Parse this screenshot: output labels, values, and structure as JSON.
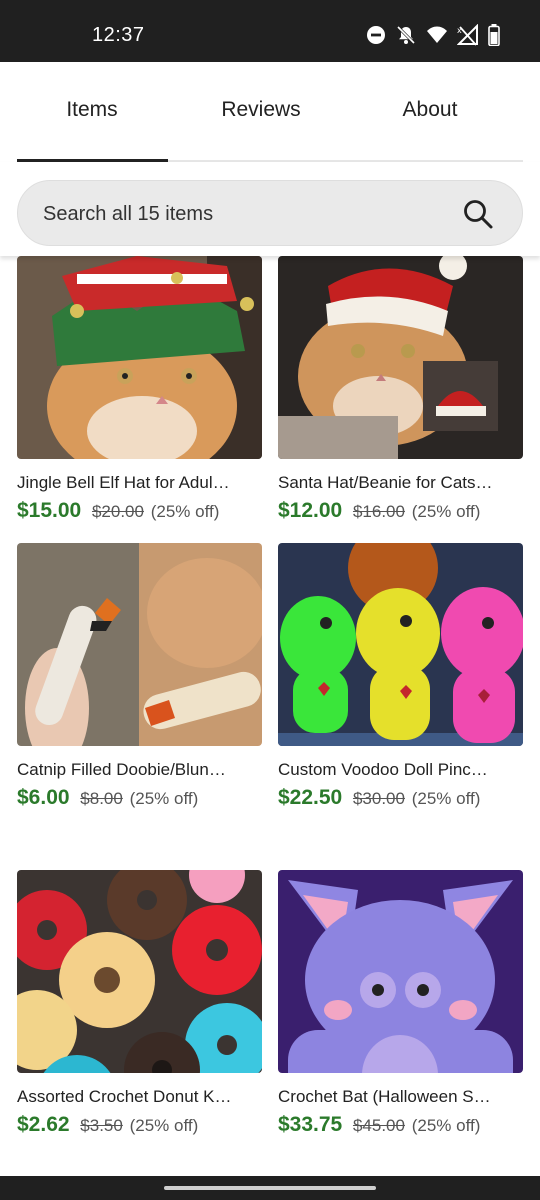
{
  "status_bar": {
    "time": "12:37",
    "icons": [
      "do-not-disturb-icon",
      "notifications-off-icon",
      "wifi-icon",
      "no-signal-icon",
      "battery-icon"
    ]
  },
  "tabs": [
    {
      "label": "Items",
      "active": true
    },
    {
      "label": "Reviews",
      "active": false
    },
    {
      "label": "About",
      "active": false
    }
  ],
  "search": {
    "placeholder": "Search all 15 items"
  },
  "items": [
    {
      "title": "Jingle Bell Elf Hat for Adul…",
      "price": "$15.00",
      "original_price": "$20.00",
      "discount": "(25% off)"
    },
    {
      "title": "Santa Hat/Beanie for Cats…",
      "price": "$12.00",
      "original_price": "$16.00",
      "discount": "(25% off)"
    },
    {
      "title": "Catnip Filled Doobie/Blun…",
      "price": "$6.00",
      "original_price": "$8.00",
      "discount": "(25% off)"
    },
    {
      "title": "Custom Voodoo Doll Pinc…",
      "price": "$22.50",
      "original_price": "$30.00",
      "discount": "(25% off)"
    },
    {
      "title": "Assorted Crochet Donut K…",
      "price": "$2.62",
      "original_price": "$3.50",
      "discount": "(25% off)"
    },
    {
      "title": "Crochet Bat (Halloween S…",
      "price": "$33.75",
      "original_price": "$45.00",
      "discount": "(25% off)"
    }
  ],
  "colors": {
    "price": "#2b7a2b",
    "status_bar": "#202020",
    "search_bg": "#eaeaea"
  }
}
